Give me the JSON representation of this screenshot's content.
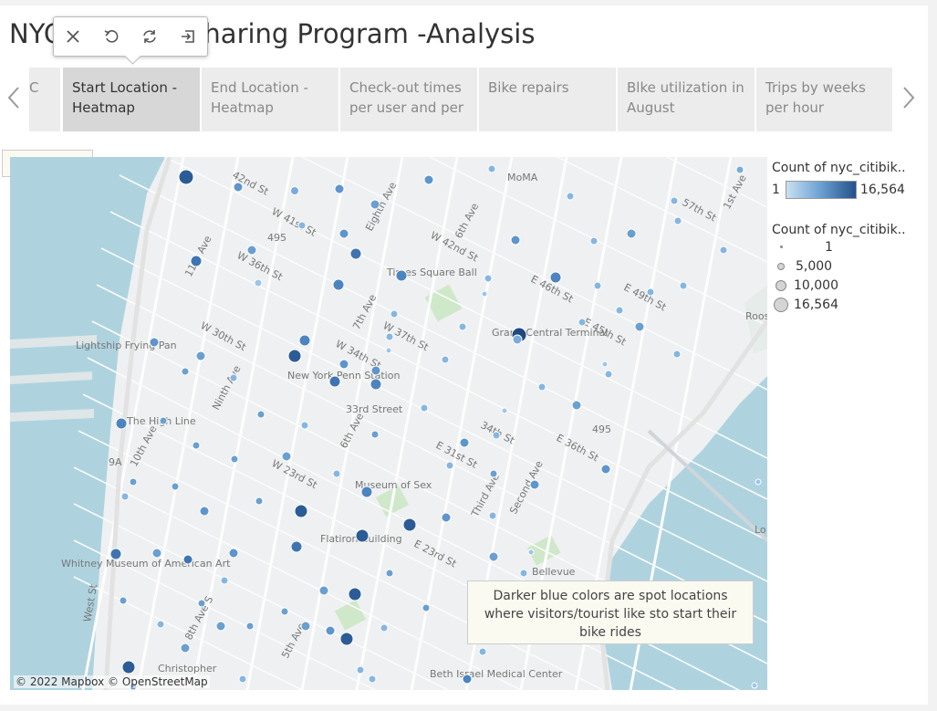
{
  "title": "NYC Citi Bike Sharing Program -Analysis",
  "toolbar": {
    "icons": [
      "close-icon",
      "undo-icon",
      "refresh-icon",
      "exit-icon"
    ]
  },
  "tabs": [
    {
      "label": "C",
      "partial": true
    },
    {
      "label": "Start Location - Heatmap",
      "active": true
    },
    {
      "label": "End Location - Heatmap"
    },
    {
      "label": "Check-out times per user and per"
    },
    {
      "label": "Bike repairs"
    },
    {
      "label": "Blke utilization in August"
    },
    {
      "label": "Trips by weeks per hour"
    }
  ],
  "legend": {
    "color_title": "Count of nyc_citibik..",
    "color_min": "1",
    "color_max": "16,564",
    "size_title": "Count of nyc_citibik..",
    "sizes": [
      "1",
      "5,000",
      "10,000",
      "16,564"
    ]
  },
  "map": {
    "copyright": "© 2022 Mapbox © OpenStreetMap",
    "annotation": "Darker blue colors are spot locations where visitors/tourist like sto start their bike rides",
    "labels": [
      "42nd St",
      "W 41st St",
      "Eighth Ave",
      "6th Ave",
      "MoMA",
      "57th St",
      "1st Ave",
      "W 36th St",
      "11th Ave",
      "W 42nd St",
      "Times Square Ball",
      "E 46th St",
      "E 49th St",
      "W 30th St",
      "7th Ave",
      "W 37th St",
      "Grand Central Terminal",
      "E 45th St",
      "Lightship Frying Pan",
      "W 34th St",
      "New York Penn Station",
      "Ninth Ave",
      "33rd Street",
      "The High Line",
      "34th St",
      "E 36th St",
      "10th Ave",
      "6th Ave",
      "E 31st St",
      "W 23rd St",
      "Museum of Sex",
      "Third Ave",
      "Second Ave",
      "Flatiron Building",
      "E 23rd St",
      "Whitney Museum of American Art",
      "Bellevue",
      "West St",
      "8th Ave S",
      "5th Ave",
      "Christopher",
      "Beth Israel Medical Center",
      "495",
      "9A",
      "495",
      "Roos Isl",
      "Lo"
    ]
  }
}
